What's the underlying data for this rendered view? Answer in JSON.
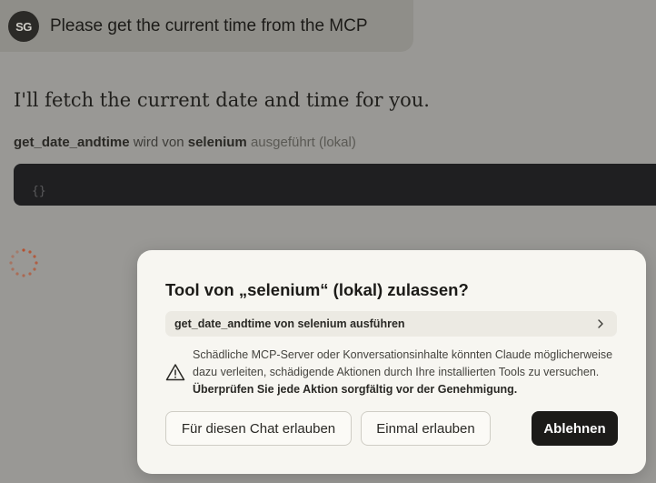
{
  "user_message": {
    "avatar_initials": "SG",
    "text": "Please get the current time from the MCP"
  },
  "assistant": {
    "text": "I'll fetch the current date and time for you.",
    "tool_call": {
      "tool_name": "get_date_andtime",
      "mid_text": "wird von",
      "server": "selenium",
      "suffix": "ausgeführt (lokal)"
    },
    "code_preview": "{}"
  },
  "dialog": {
    "title": "Tool von „selenium“ (lokal) zulassen?",
    "action_label": "get_date_andtime von selenium ausführen",
    "warning_text": "Schädliche MCP-Server oder Konversationsinhalte könnten Claude möglicherweise dazu verleiten, schädigende Aktionen durch Ihre installierten Tools zu versuchen. ",
    "warning_bold": "Überprüfen Sie jede Aktion sorgfältig vor der Genehmigung.",
    "buttons": {
      "allow_chat": "Für diesen Chat erlauben",
      "allow_once": "Einmal erlauben",
      "deny": "Ablehnen"
    }
  },
  "colors": {
    "overlay_background": "#999895",
    "dialog_background": "#f7f6f1",
    "primary_button": "#1c1b19",
    "spinner": "#b5502f"
  }
}
